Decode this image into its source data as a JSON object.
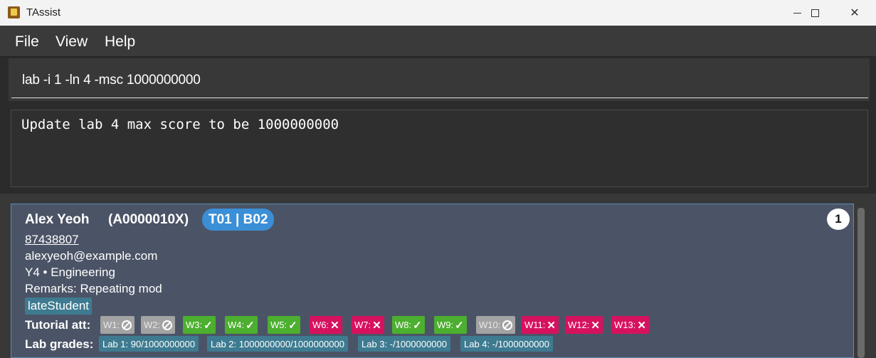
{
  "window": {
    "title": "TAssist"
  },
  "menu": {
    "file": "File",
    "view": "View",
    "help": "Help"
  },
  "command": {
    "value": "lab -i 1 -ln 4 -msc 1000000000"
  },
  "result": {
    "text": "Update lab 4 max score to be 1000000000"
  },
  "student": {
    "index": "1",
    "name": "Alex Yeoh",
    "id": "(A0000010X)",
    "groups": "T01 | B02",
    "phone": "87438807",
    "email": "alexyeoh@example.com",
    "year_faculty": "Y4  •  Engineering",
    "remarks": "Remarks: Repeating mod",
    "tag": "lateStudent",
    "attendance_label": "Tutorial att:",
    "attendance": [
      {
        "week": "W1:",
        "status": "excused",
        "color": "#a3a3a3"
      },
      {
        "week": "W2:",
        "status": "excused",
        "color": "#a3a3a3"
      },
      {
        "week": "W3:",
        "status": "present",
        "color": "#4caf2f"
      },
      {
        "week": "W4:",
        "status": "present",
        "color": "#4caf2f"
      },
      {
        "week": "W5:",
        "status": "present",
        "color": "#4caf2f"
      },
      {
        "week": "W6:",
        "status": "absent",
        "color": "#d6125f"
      },
      {
        "week": "W7:",
        "status": "absent",
        "color": "#d6125f"
      },
      {
        "week": "W8:",
        "status": "present",
        "color": "#4caf2f"
      },
      {
        "week": "W9:",
        "status": "present",
        "color": "#4caf2f"
      },
      {
        "week": "W10:",
        "status": "excused",
        "color": "#a3a3a3"
      },
      {
        "week": "W11:",
        "status": "absent",
        "color": "#d6125f"
      },
      {
        "week": "W12:",
        "status": "absent",
        "color": "#d6125f"
      },
      {
        "week": "W13:",
        "status": "absent",
        "color": "#d6125f"
      }
    ],
    "lab_label": "Lab grades:",
    "labs": [
      "Lab 1: 90/1000000000",
      "Lab 2: 1000000000/1000000000",
      "Lab 3: -/1000000000",
      "Lab 4: -/1000000000"
    ]
  }
}
